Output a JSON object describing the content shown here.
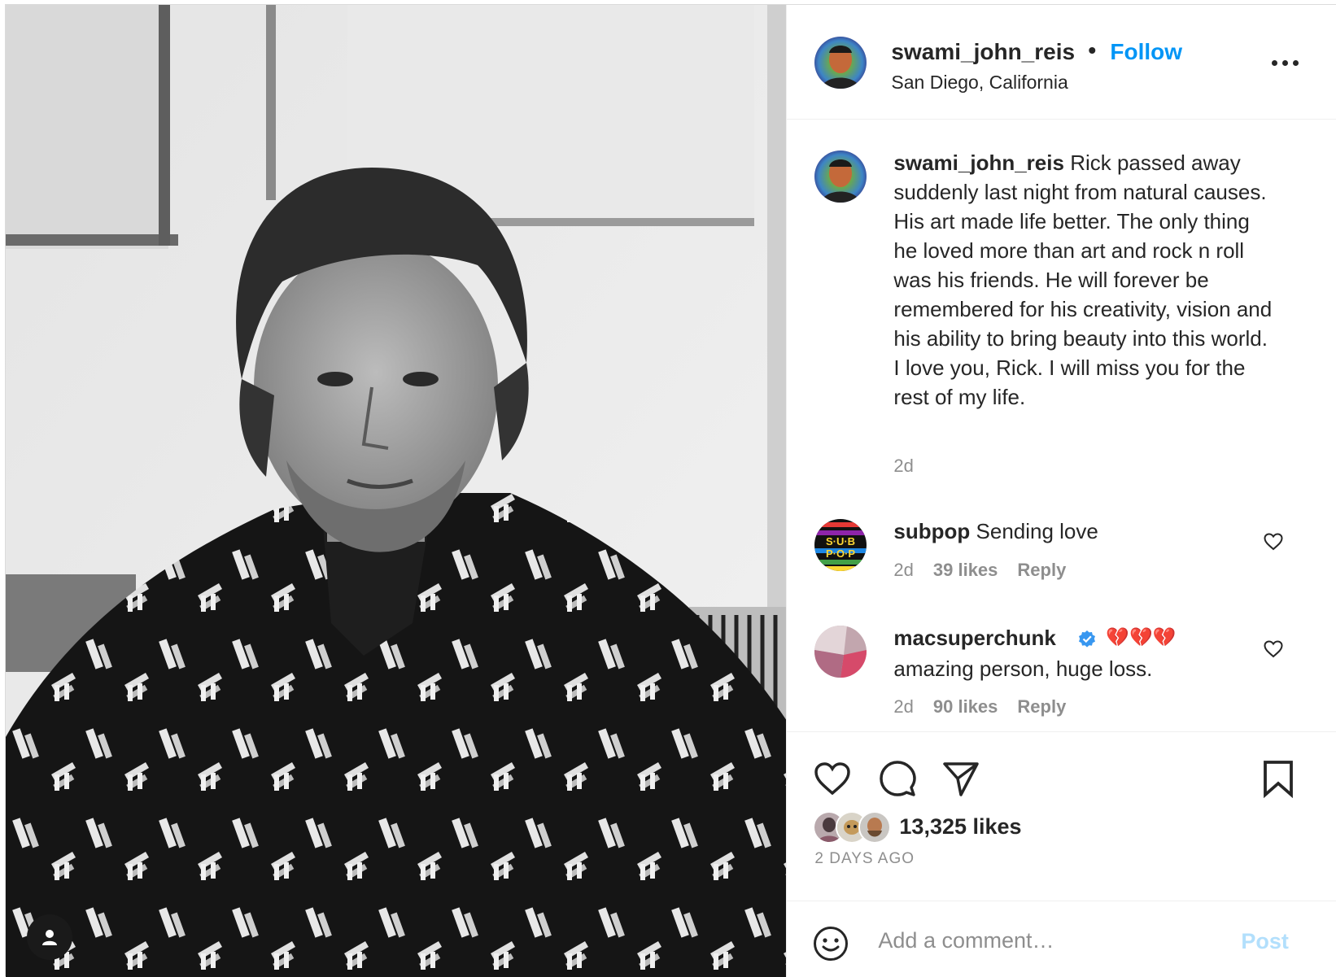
{
  "post": {
    "username": "swami_john_reis",
    "separator": "•",
    "follow_label": "Follow",
    "location": "San Diego, California"
  },
  "caption": {
    "username": "swami_john_reis",
    "text": "Rick passed away suddenly last night from natural causes. His art made life better. The only thing he loved more than art and rock n roll was his friends. He will forever be remembered for his creativity, vision and his ability to bring beauty into this world. I love you, Rick. I will miss you for the rest of my life.",
    "time": "2d"
  },
  "comments": [
    {
      "username": "subpop",
      "text": "Sending love",
      "time": "2d",
      "likes": "39 likes",
      "reply_label": "Reply",
      "avatar_text": [
        "S·U·B",
        "P·O·P"
      ]
    },
    {
      "username": "macsuperchunk",
      "verified": true,
      "emoji": "💔💔💔",
      "text": "amazing person, huge loss.",
      "time": "2d",
      "likes": "90 likes",
      "reply_label": "Reply"
    }
  ],
  "actions": {
    "icons": [
      "heart-icon",
      "comment-icon",
      "share-icon",
      "bookmark-icon"
    ]
  },
  "stats": {
    "likes": "13,325 likes",
    "time_ago": "2 DAYS AGO"
  },
  "comment_box": {
    "placeholder": "Add a comment…",
    "post_label": "Post"
  },
  "colors": {
    "accent": "#0095f6",
    "post_disabled": "#b2dffc",
    "text": "#262626",
    "muted": "#8e8e8e",
    "verified": "#3897f0",
    "broken_heart": "#d1142a"
  }
}
